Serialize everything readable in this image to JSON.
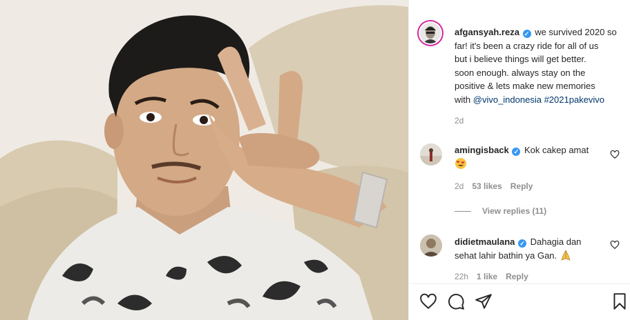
{
  "post": {
    "author": "afgansyah.reza",
    "caption_lines": [
      "we survived 2020 so",
      "far! it's been a crazy ride for all of us",
      "but i believe things will get better.",
      "soon enough. always stay on the",
      "positive & lets make new memories",
      "with"
    ],
    "mention": "@vivo_indonesia",
    "hashtag": "#2021pakevivo",
    "age": "2d"
  },
  "comments": [
    {
      "username": "amingisback",
      "text": "Kok cakep amat",
      "emoji": "heart-eyes-emoji",
      "age": "2d",
      "likes": "53 likes",
      "reply_label": "Reply",
      "view_replies": "View replies (11)"
    },
    {
      "username": "didietmaulana",
      "text_line1": "Dahagia dan",
      "text_line2": "sehat lahir bathin ya Gan.",
      "emoji": "praying-emoji",
      "age": "22h",
      "likes": "1 like",
      "reply_label": "Reply"
    }
  ],
  "icons": {
    "verified": "verified-badge-icon",
    "like": "heart-icon",
    "comment": "comment-bubble-icon",
    "share": "paper-plane-icon",
    "save": "bookmark-icon"
  },
  "colors": {
    "text": "#262626",
    "secondary": "#8e8e8e",
    "link": "#00376b",
    "verified": "#3897f0"
  }
}
